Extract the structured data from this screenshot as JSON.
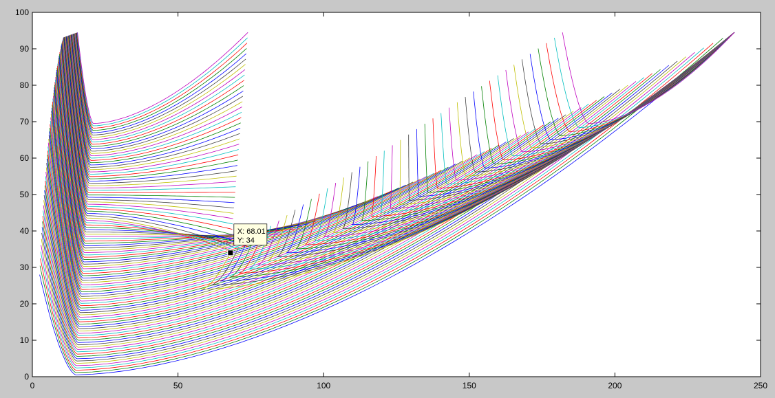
{
  "colors": {
    "figure_background": "#c8c8c8",
    "axes_background": "#ffffff",
    "axes_color": "#000000",
    "series_color_order": [
      "#0000ff",
      "#008000",
      "#ff0000",
      "#00bfbf",
      "#bf00bf",
      "#bfbf00",
      "#404040"
    ]
  },
  "chart_data": {
    "type": "line",
    "title": "",
    "xlabel": "",
    "ylabel": "",
    "xlim": [
      0,
      250
    ],
    "ylim": [
      0,
      100
    ],
    "xticks": [
      0,
      50,
      100,
      150,
      200,
      250
    ],
    "yticks": [
      0,
      10,
      20,
      30,
      40,
      50,
      60,
      70,
      80,
      90,
      100
    ],
    "xtick_labels": [
      "0",
      "50",
      "100",
      "150",
      "200",
      "250"
    ],
    "ytick_labels": [
      "0",
      "10",
      "20",
      "30",
      "40",
      "50",
      "60",
      "70",
      "80",
      "90",
      "100"
    ],
    "grid": false,
    "legend": false,
    "families": [
      {
        "description_free": true,
        "count": 110,
        "vertex_start": [
          15,
          0.5
        ],
        "vertex_end": [
          21,
          69.5
        ],
        "min_y_start": 0.5,
        "min_y_end": 69.5,
        "right_end_start": [
          241,
          94.5
        ],
        "right_end_end": [
          74,
          94.5
        ],
        "left_end_start": [
          2.5,
          94.5
        ],
        "left_end_end": [
          15.5,
          94.5
        ]
      },
      {
        "description_free": true,
        "count": 42,
        "vertex_start": [
          58,
          24
        ],
        "vertex_end": [
          191,
          69.5
        ],
        "right_end": [
          241,
          94.5
        ],
        "left_end_start": [
          68,
          34
        ],
        "left_end_end": [
          182,
          94.5
        ]
      }
    ],
    "datatip": {
      "x": 68.01,
      "y": 34,
      "x_text": "X: 68.01",
      "y_text": "Y: 34"
    }
  }
}
